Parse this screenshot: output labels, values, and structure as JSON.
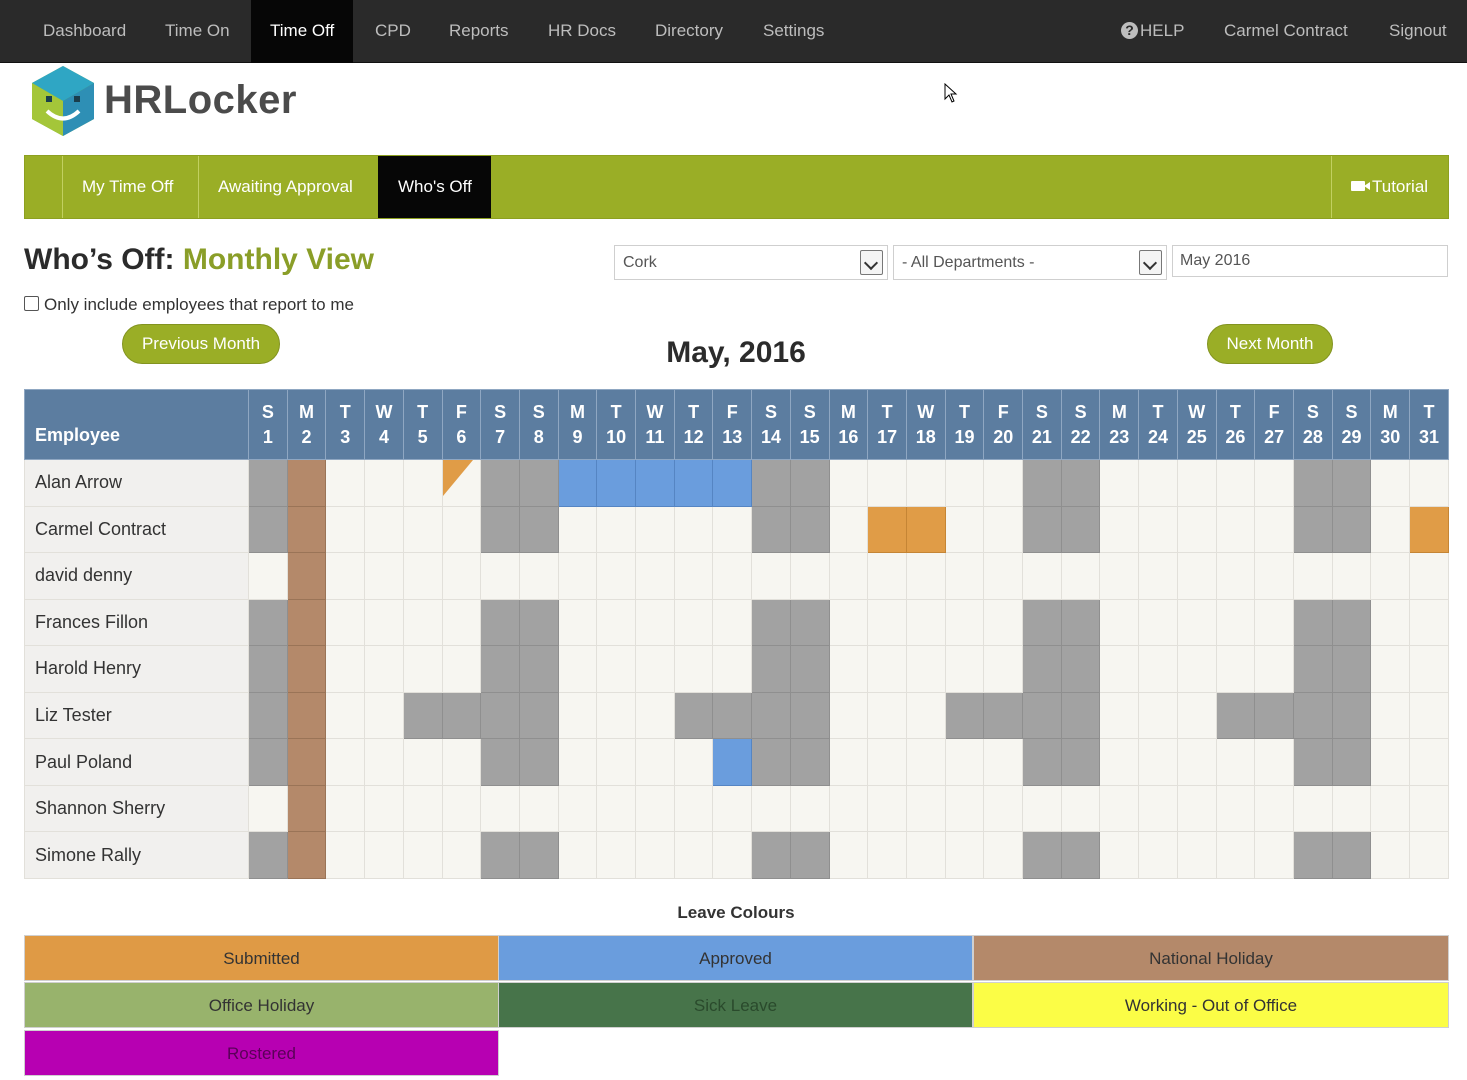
{
  "topnav": {
    "left": [
      "Dashboard",
      "Time On",
      "Time Off",
      "CPD",
      "Reports",
      "HR Docs",
      "Directory",
      "Settings"
    ],
    "active": "Time Off",
    "help": "HELP",
    "user": "Carmel Contract",
    "signout": "Signout"
  },
  "brand": {
    "name": "HRLocker"
  },
  "subnav": {
    "items": [
      "My Time Off",
      "Awaiting Approval",
      "Who's Off"
    ],
    "active": "Who's Off",
    "tutorial": "Tutorial"
  },
  "page": {
    "title_prefix": "Who’s Off:",
    "title_suffix": "Monthly View",
    "location": "Cork",
    "department": "- All Departments -",
    "month_value": "May 2016",
    "only_reports_label": "Only include employees that report to me",
    "prev_label": "Previous Month",
    "next_label": "Next Month",
    "month_title": "May, 2016"
  },
  "calendar": {
    "employee_header": "Employee",
    "day_letters": [
      "S",
      "M",
      "T",
      "W",
      "T",
      "F",
      "S",
      "S",
      "M",
      "T",
      "W",
      "T",
      "F",
      "S",
      "S",
      "M",
      "T",
      "W",
      "T",
      "F",
      "S",
      "S",
      "M",
      "T",
      "W",
      "T",
      "F",
      "S",
      "S",
      "M",
      "T"
    ],
    "rows": [
      {
        "name": "Alan Arrow",
        "cells": {
          "1": "we",
          "2": "nat",
          "6": "half",
          "7": "we",
          "8": "we",
          "9": "appr",
          "10": "appr",
          "11": "appr",
          "12": "appr",
          "13": "appr",
          "14": "we",
          "15": "we",
          "21": "we",
          "22": "we",
          "28": "we",
          "29": "we"
        }
      },
      {
        "name": "Carmel Contract",
        "cells": {
          "1": "we",
          "2": "nat",
          "7": "we",
          "8": "we",
          "14": "we",
          "15": "we",
          "17": "sub",
          "18": "sub",
          "21": "we",
          "22": "we",
          "28": "we",
          "29": "we",
          "31": "sub"
        }
      },
      {
        "name": "david denny",
        "cells": {
          "2": "nat"
        }
      },
      {
        "name": "Frances Fillon",
        "cells": {
          "1": "we",
          "2": "nat",
          "7": "we",
          "8": "we",
          "14": "we",
          "15": "we",
          "21": "we",
          "22": "we",
          "28": "we",
          "29": "we"
        }
      },
      {
        "name": "Harold Henry",
        "cells": {
          "1": "we",
          "2": "nat",
          "7": "we",
          "8": "we",
          "14": "we",
          "15": "we",
          "21": "we",
          "22": "we",
          "28": "we",
          "29": "we"
        }
      },
      {
        "name": "Liz Tester",
        "cells": {
          "1": "we",
          "2": "nat",
          "5": "we",
          "6": "we",
          "7": "we",
          "8": "we",
          "12": "we",
          "13": "we",
          "14": "we",
          "15": "we",
          "19": "we",
          "20": "we",
          "21": "we",
          "22": "we",
          "26": "we",
          "27": "we",
          "28": "we",
          "29": "we"
        }
      },
      {
        "name": "Paul Poland",
        "cells": {
          "1": "we",
          "2": "nat",
          "7": "we",
          "8": "we",
          "13": "appr",
          "14": "we",
          "15": "we",
          "21": "we",
          "22": "we",
          "28": "we",
          "29": "we"
        }
      },
      {
        "name": "Shannon Sherry",
        "cells": {
          "2": "nat"
        }
      },
      {
        "name": "Simone Rally",
        "cells": {
          "1": "we",
          "2": "nat",
          "7": "we",
          "8": "we",
          "14": "we",
          "15": "we",
          "21": "we",
          "22": "we",
          "28": "we",
          "29": "we"
        }
      }
    ]
  },
  "legend": {
    "title": "Leave Colours",
    "items": [
      {
        "label": "Submitted",
        "color": "#df9a45",
        "text": "#333333"
      },
      {
        "label": "Approved",
        "color": "#6a9ddd",
        "text": "#333333"
      },
      {
        "label": "National Holiday",
        "color": "#b4896a",
        "text": "#333333"
      },
      {
        "label": "Office Holiday",
        "color": "#98b36c",
        "text": "#333333"
      },
      {
        "label": "Sick Leave",
        "color": "#47744a",
        "text": "#2a4a2c"
      },
      {
        "label": "Working - Out of Office",
        "color": "#fbfd46",
        "text": "#333333"
      },
      {
        "label": "Rostered",
        "color": "#b700b2",
        "text": "#5a0058"
      }
    ]
  }
}
